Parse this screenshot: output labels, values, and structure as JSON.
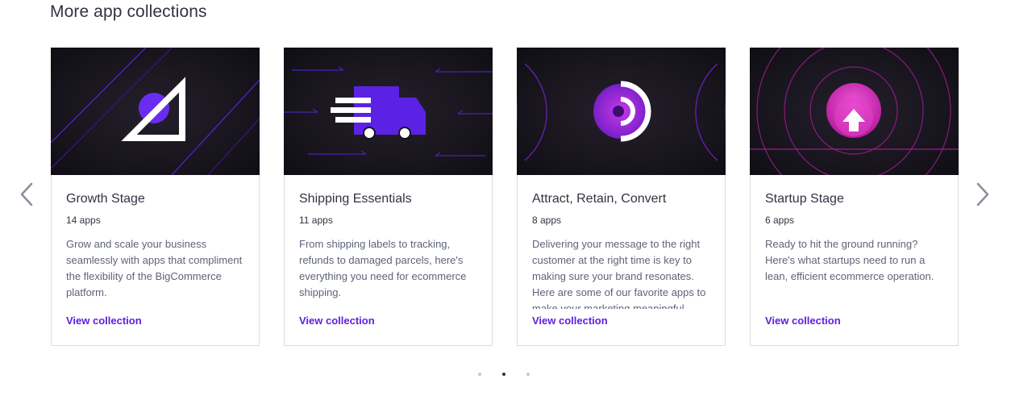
{
  "section": {
    "title": "More app collections"
  },
  "carousel": {
    "prev_icon": "chevron-left-icon",
    "next_icon": "chevron-right-icon",
    "dots": [
      {
        "active": false
      },
      {
        "active": true
      },
      {
        "active": false
      }
    ]
  },
  "colors": {
    "accent": "#5f1ee0",
    "image_bg": "#16131c",
    "card_border": "#dcdde3"
  },
  "cards": [
    {
      "title": "Growth Stage",
      "count": "14 apps",
      "description": "Grow and scale your business seamlessly with apps that compliment the flexibility of the BigCommerce platform.",
      "link": "View collection",
      "icon": "circle-triangle-icon"
    },
    {
      "title": "Shipping Essentials",
      "count": "11 apps",
      "description": "From shipping labels to tracking, refunds to damaged parcels, here's everything you need for ecommerce shipping.",
      "link": "View collection",
      "icon": "delivery-truck-icon"
    },
    {
      "title": "Attract, Retain, Convert",
      "count": "8 apps",
      "description": "Delivering your message to the right customer at the right time is key to making sure your brand resonates. Here are some of our favorite apps to make your marketing meaningful.",
      "link": "View collection",
      "icon": "target-rings-icon"
    },
    {
      "title": "Startup Stage",
      "count": "6 apps",
      "description": "Ready to hit the ground running? Here's what startups need to run a lean, efficient ecommerce operation.",
      "link": "View collection",
      "icon": "rocket-arrow-icon"
    }
  ]
}
